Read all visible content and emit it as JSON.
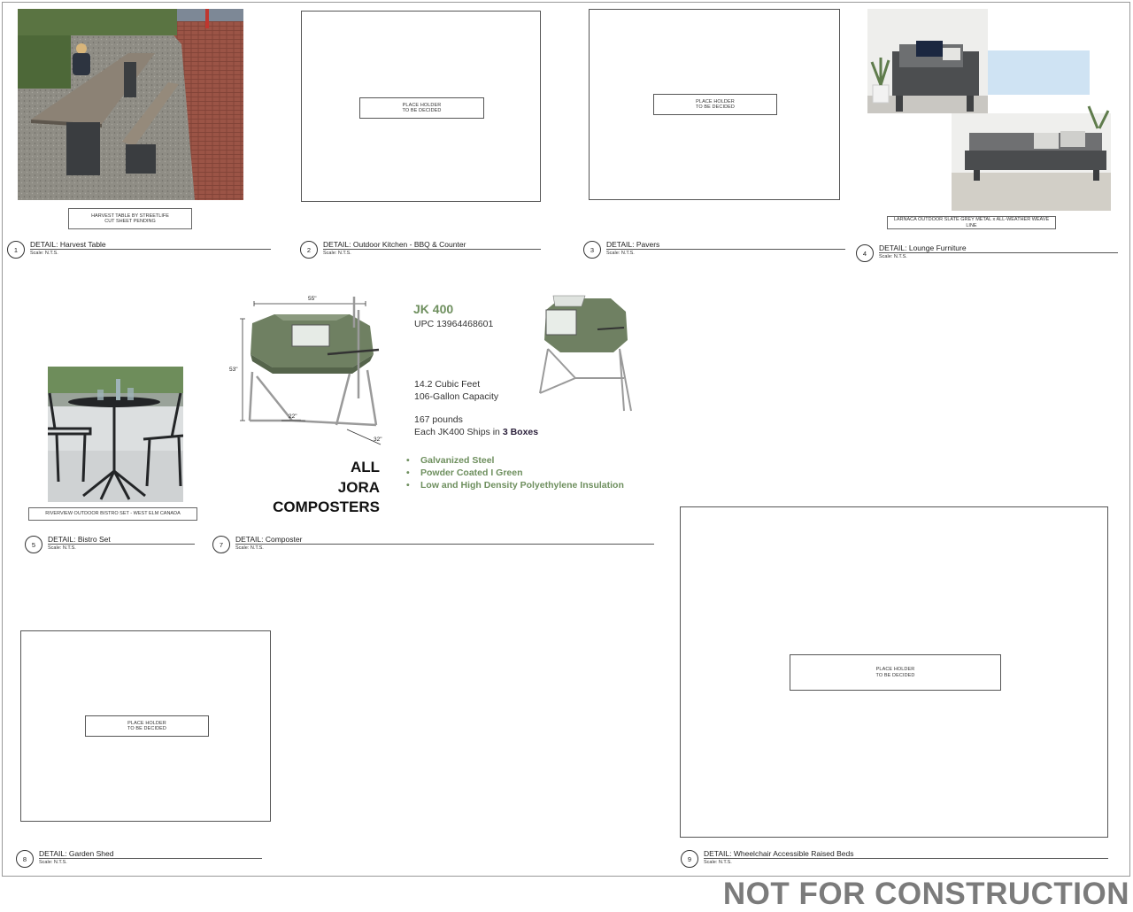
{
  "stamp": "NOT FOR CONSTRUCTION",
  "placeholder": {
    "line1": "PLACE HOLDER",
    "line2": "TO BE DECIDED"
  },
  "details": [
    {
      "num": "1",
      "title": "DETAIL: Harvest Table",
      "scale": "Scale: N.T.S."
    },
    {
      "num": "2",
      "title": "DETAIL: Outdoor Kitchen - BBQ & Counter",
      "scale": "Scale: N.T.S."
    },
    {
      "num": "3",
      "title": "DETAIL: Pavers",
      "scale": "Scale: N.T.S."
    },
    {
      "num": "4",
      "title": "DETAIL: Lounge Furniture",
      "scale": "Scale: N.T.S."
    },
    {
      "num": "5",
      "title": "DETAIL: Bistro Set",
      "scale": "Scale: N.T.S."
    },
    {
      "num": "7",
      "title": "DETAIL: Composter",
      "scale": "Scale: N.T.S."
    },
    {
      "num": "8",
      "title": "DETAIL: Garden Shed",
      "scale": "Scale: N.T.S."
    },
    {
      "num": "9",
      "title": "DETAIL: Wheelchair Accessible Raised Beds",
      "scale": "Scale: N.T.S."
    }
  ],
  "captions": {
    "harvest_line1": "HARVEST TABLE BY STREETLIFE",
    "harvest_line2": "CUT SHEET PENDING",
    "lounge": "LARNACA OUTDOOR SLATE GREY METAL x ALL-WEATHER WEAVE LINE",
    "bistro": "RIVERVIEW OUTDOOR BISTRO SET - WEST ELM CANADA"
  },
  "composter": {
    "model": "JK 400",
    "upc": "UPC 13964468601",
    "volume1": "14.2 Cubic Feet",
    "volume2": "106-Gallon Capacity",
    "weight": "167 pounds",
    "ships_prefix": "Each JK400 Ships in ",
    "ships_bold": "3 Boxes",
    "features": [
      "Galvanized Steel",
      "Powder Coated I Green",
      "Low and High Density Polyethylene Insulation"
    ],
    "brand_line1": "ALL",
    "brand_line2": "JORA",
    "brand_line3": "COMPOSTERS",
    "dim_width": "55\"",
    "dim_height": "53\"",
    "dim_depth": "32\"",
    "dim_leg": "22\""
  }
}
